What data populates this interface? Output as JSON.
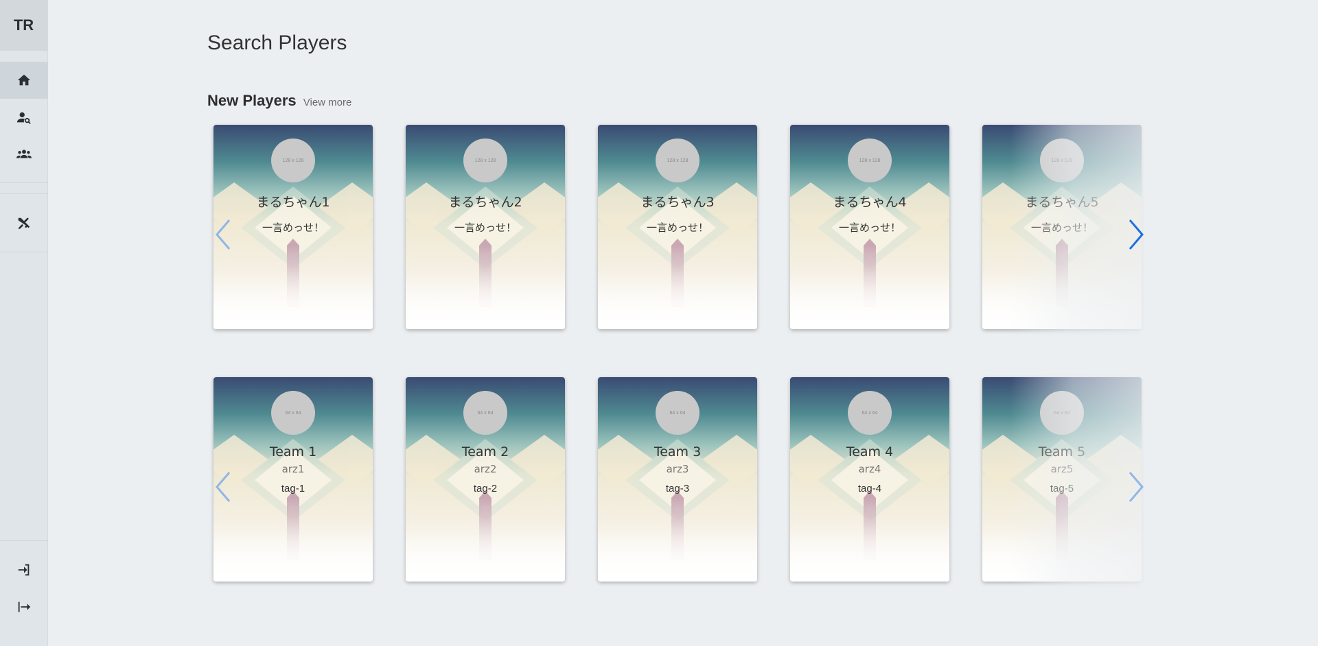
{
  "sidebar": {
    "logo": "TR",
    "items": [
      {
        "icon": "home-icon"
      },
      {
        "icon": "search-user-icon"
      },
      {
        "icon": "users-icon"
      },
      {
        "icon": "crossed-swords-icon"
      }
    ],
    "bottom_items": [
      {
        "icon": "login-icon"
      },
      {
        "icon": "logout-icon"
      }
    ]
  },
  "page": {
    "title": "Search Players"
  },
  "new_players": {
    "title": "New Players",
    "view_more": "View more",
    "avatar_placeholder": "128 x 128",
    "cards": [
      {
        "name": "まるちゃん1",
        "message": "一言めっせ！"
      },
      {
        "name": "まるちゃん2",
        "message": "一言めっせ！"
      },
      {
        "name": "まるちゃん3",
        "message": "一言めっせ！"
      },
      {
        "name": "まるちゃん4",
        "message": "一言めっせ！"
      },
      {
        "name": "まるちゃん5",
        "message": "一言めっせ！"
      }
    ]
  },
  "teams": {
    "avatar_placeholder": "64 x 64",
    "cards": [
      {
        "name": "Team 1",
        "short": "arz1",
        "tag": "tag-1"
      },
      {
        "name": "Team 2",
        "short": "arz2",
        "tag": "tag-2"
      },
      {
        "name": "Team 3",
        "short": "arz3",
        "tag": "tag-3"
      },
      {
        "name": "Team 4",
        "short": "arz4",
        "tag": "tag-4"
      },
      {
        "name": "Team 5",
        "short": "arz5",
        "tag": "tag-5"
      }
    ]
  },
  "colors": {
    "accent": "#1e6fe0",
    "arrow_faded": "#8fb6e8"
  }
}
